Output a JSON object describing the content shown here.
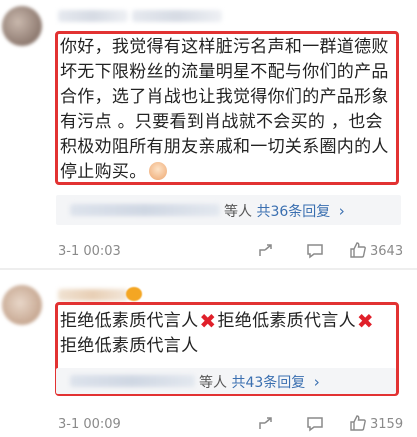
{
  "comments": [
    {
      "body_lines": [
        "你好，我觉得有这样脏污名声和一群道德败",
        "坏无下限粉丝的流量明星不配与你们的产品",
        "合作，选了肖战也让我觉得你们的产品形象",
        "有污点 。只要看到肖战就不会买的 ，也会",
        "积极劝阻所有朋友亲戚和一切关系圈内的人",
        "停止购买。"
      ],
      "replies_suffix": "等人",
      "replies_link": "共36条回复",
      "time": "3-1 00:03",
      "like_count": "3643"
    },
    {
      "body_line1_parts": [
        "拒绝低素质代言人",
        "拒绝低素质代言人"
      ],
      "body_line2": "拒绝低素质代言人",
      "x_glyph": "✖",
      "replies_suffix": "等人",
      "replies_link": "共43条回复",
      "time": "3-1 00:09",
      "like_count": "3159"
    }
  ],
  "chevron": "›",
  "colors": {
    "highlight_border": "#e23232",
    "link": "#3a6fb0"
  }
}
